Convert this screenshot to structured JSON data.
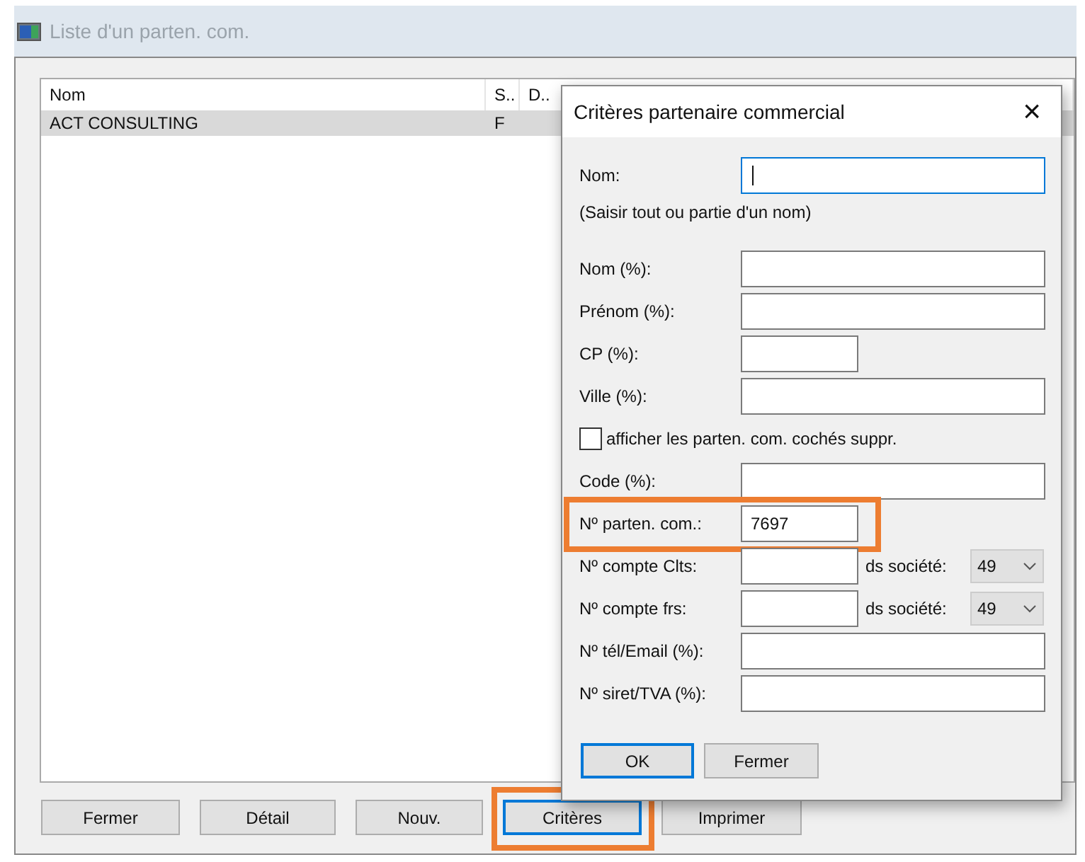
{
  "window": {
    "title": "Liste d'un parten. com."
  },
  "list": {
    "columns": [
      "Nom",
      "S..",
      "D.."
    ],
    "rows": [
      {
        "cells": [
          "ACT CONSULTING",
          "F",
          ""
        ],
        "selected": true
      }
    ]
  },
  "buttons": [
    {
      "label": "Fermer",
      "focused": false,
      "highlighted": false
    },
    {
      "label": "Détail",
      "focused": false,
      "highlighted": false
    },
    {
      "label": "Nouv.",
      "focused": false,
      "highlighted": false
    },
    {
      "label": "Critères",
      "focused": true,
      "highlighted": true
    },
    {
      "label": "Imprimer",
      "focused": false,
      "highlighted": false
    }
  ],
  "dialog": {
    "title": "Critères partenaire commercial",
    "close": "×",
    "fields": [
      {
        "kind": "text",
        "label": "Nom:",
        "focused": true,
        "highlighted": false
      },
      {
        "kind": "hint",
        "label": "(Saisir tout ou partie d'un nom)"
      },
      {
        "kind": "text",
        "label": "Nom (%):",
        "focused": false,
        "highlighted": false
      },
      {
        "kind": "text",
        "label": "Prénom (%):",
        "focused": false,
        "highlighted": false
      },
      {
        "kind": "short",
        "label": "CP (%):",
        "focused": false,
        "highlighted": false
      },
      {
        "kind": "text",
        "label": "Ville (%):",
        "focused": false,
        "highlighted": false
      },
      {
        "kind": "checkbox",
        "label": "afficher les parten. com. cochés suppr.",
        "checked": false
      },
      {
        "kind": "text",
        "label": "Code (%):",
        "focused": false,
        "highlighted": false
      },
      {
        "kind": "short",
        "label": "Nº parten. com.:",
        "value": "7697",
        "focused": false,
        "highlighted": true
      },
      {
        "kind": "account",
        "label": "Nº compte Clts:",
        "company_label": "ds société:",
        "company": "49"
      },
      {
        "kind": "account",
        "label": "Nº compte frs:",
        "company_label": "ds société:",
        "company": "49"
      },
      {
        "kind": "text",
        "label": "Nº tél/Email (%):",
        "focused": false,
        "highlighted": false
      },
      {
        "kind": "text",
        "label": "Nº siret/TVA (%):",
        "focused": false,
        "highlighted": false
      }
    ],
    "buttons": [
      {
        "label": "OK",
        "default": true
      },
      {
        "label": "Fermer",
        "default": false
      }
    ]
  }
}
